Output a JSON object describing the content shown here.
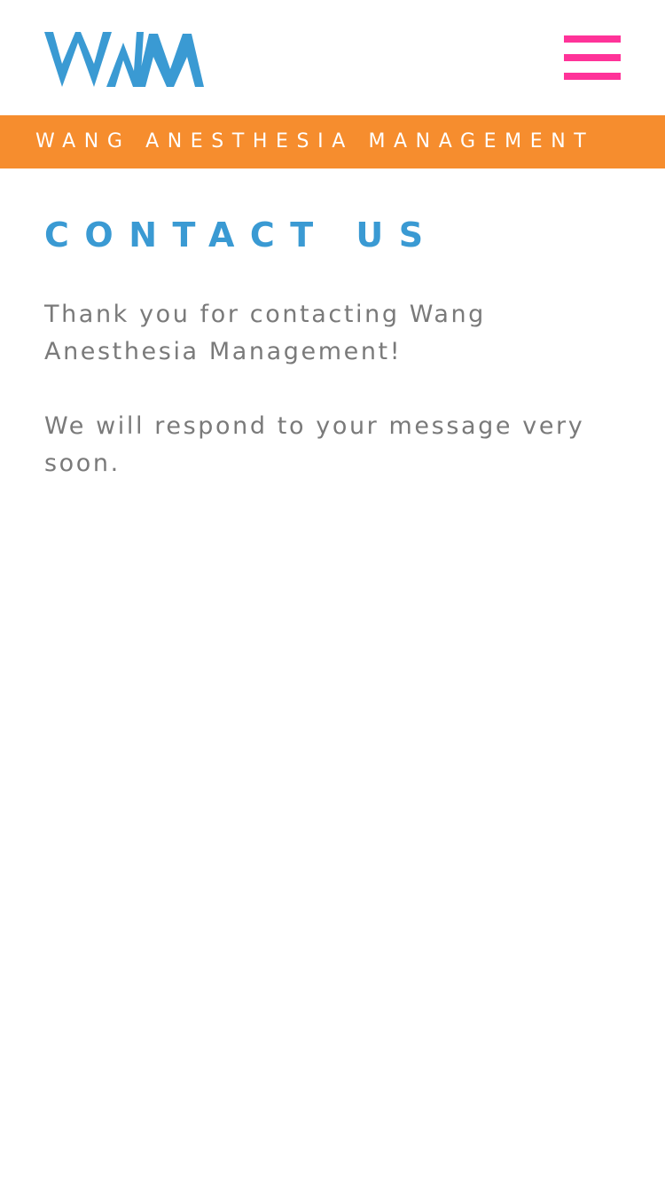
{
  "header": {
    "logo_text": "WAM",
    "menu_icon": "hamburger-menu-icon"
  },
  "banner": {
    "text": "WANG ANESTHESIA MANAGEMENT"
  },
  "main": {
    "title": "CONTACT US",
    "paragraphs": [
      "Thank you for contacting Wang Anesthesia Management!",
      "We will respond to your message very soon."
    ]
  },
  "colors": {
    "brand_blue": "#3a9ad3",
    "menu_pink": "#ff3399",
    "banner_orange": "#f68d2e",
    "body_text_gray": "#7a7a7a",
    "background": "#ffffff"
  }
}
